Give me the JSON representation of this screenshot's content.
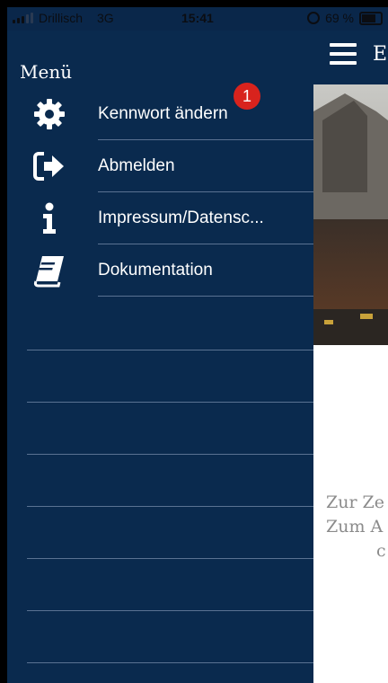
{
  "status_bar": {
    "carrier": "Drillisch",
    "network": "3G",
    "time": "15:41",
    "battery": "69 %",
    "battery_level": 0.69
  },
  "drawer": {
    "title": "Menü",
    "items": [
      {
        "label": "Kennwort ändern",
        "icon": "gear-icon"
      },
      {
        "label": "Abmelden",
        "icon": "sign-out-icon"
      },
      {
        "label": "Impressum/Datensc...",
        "icon": "info-icon"
      },
      {
        "label": "Dokumentation",
        "icon": "book-icon"
      }
    ],
    "badge": "1"
  },
  "app": {
    "title_initial": "E",
    "note_lines": [
      "Zur Ze",
      "Zum A",
      "c"
    ]
  },
  "colors": {
    "drawer_bg": "#0a2a4e",
    "divider": "#5a7292",
    "badge": "#d8231d",
    "note_text": "#8b8b8b"
  }
}
